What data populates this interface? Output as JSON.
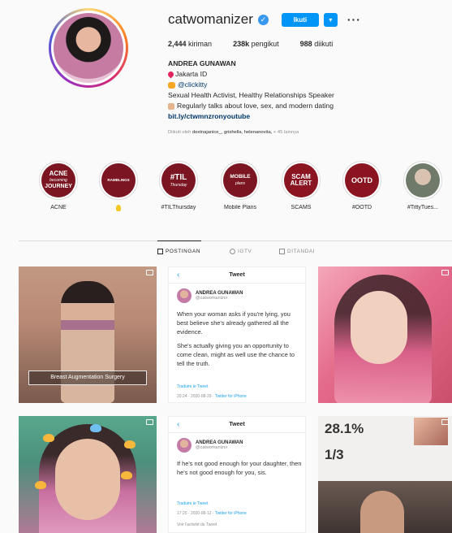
{
  "profile": {
    "username": "catwomanizer",
    "follow_label": "Ikuti",
    "dropdown_label": "▾",
    "more_label": "···",
    "stats": [
      {
        "value": "2,444",
        "label": "kiriman"
      },
      {
        "value": "238k",
        "label": "pengikut"
      },
      {
        "value": "988",
        "label": "diikuti"
      }
    ],
    "full_name": "ANDREA GUNAWAN",
    "location": "Jakarta ID",
    "mention": "@clickitty",
    "tagline": "Sexual Health Activist, Healthy Relationships Speaker",
    "regularly": "Regularly talks about love, sex, and modern dating",
    "link": "bit.ly/ctwmnzronyoutube",
    "followed_prefix": "Diikuti oleh",
    "followed_names": "dextnajanice_, grishella, helenanovita,",
    "followed_suffix": "+ 45 lainnya"
  },
  "highlights": [
    {
      "cover_lines": [
        "ACNE",
        "becoming",
        "JOURNEY"
      ],
      "label": "ACNE"
    },
    {
      "cover_lines": [
        "RAMBLINGS"
      ],
      "label": ""
    },
    {
      "cover_lines": [
        "#TIL",
        "Thursday"
      ],
      "label": "#TILThursday"
    },
    {
      "cover_lines": [
        "MOBILE",
        "plans"
      ],
      "label": "Mobile Plans"
    },
    {
      "cover_lines": [
        "SCAM",
        "ALERT"
      ],
      "label": "SCAMS"
    },
    {
      "cover_lines": [
        "OOTD"
      ],
      "label": "#OOTD"
    },
    {
      "cover_lines": [],
      "label": "#TittyTues..."
    }
  ],
  "tabs": [
    {
      "label": "POSTINGAN",
      "icon": "grid-icon",
      "active": true
    },
    {
      "label": "IGTV",
      "icon": "igtv-icon",
      "active": false
    },
    {
      "label": "DITANDAI",
      "icon": "tagged-icon",
      "active": false
    }
  ],
  "posts": {
    "p1_caption": "Breast Augmentation Surgery",
    "tweet1": {
      "header": "Tweet",
      "name": "ANDREA GUNAWAN",
      "handle": "@catwomanizer",
      "paragraphs": [
        "When your woman asks if you're lying, you best believe she's already gathered all the evidence.",
        "She's actually giving you an opportunity to come clean, might as well use the chance to tell the truth."
      ],
      "translate": "Traduire le Tweet",
      "time": "20:24 · 2020-08-29 ·",
      "client": "Twitter for iPhone"
    },
    "tweet2": {
      "header": "Tweet",
      "name": "ANDREA GUNAWAN",
      "handle": "@catwomanizer",
      "paragraphs": [
        "If he's not good enough for your daughter, then he's not good enough for you, sis."
      ],
      "translate": "Traduire le Tweet",
      "time": "17:25 · 2020-08-12 ·",
      "client": "Twitter for iPhone",
      "activity": "Voir l'activité du Tweet"
    },
    "p6_percent": "28.1%",
    "p6_fraction": "1/3"
  }
}
